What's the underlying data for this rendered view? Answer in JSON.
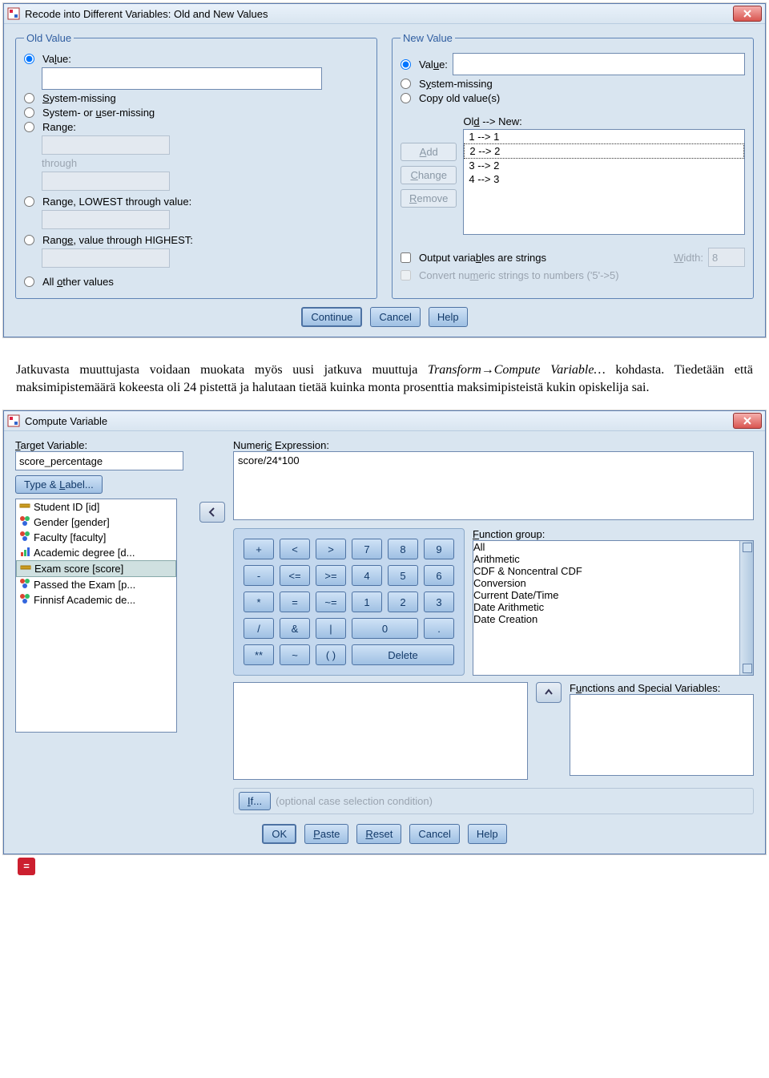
{
  "dialog1": {
    "title": "Recode into Different Variables: Old and New Values",
    "old": {
      "legend": "Old Value",
      "value_label": "Value:",
      "system_missing": "System-missing",
      "system_or_user": "System- or user-missing",
      "range_label": "Range:",
      "through": "through",
      "range_lowest": "Range, LOWEST through value:",
      "range_highest": "Range, value through HIGHEST:",
      "all_other": "All other values"
    },
    "new": {
      "legend": "New Value",
      "value_label": "Value:",
      "system_missing": "System-missing",
      "copy_old": "Copy old value(s)",
      "oldnew_label": "Old --> New:",
      "rules": [
        "1 --> 1",
        "2 --> 2",
        "3 --> 2",
        "4 --> 3"
      ],
      "add": "Add",
      "change": "Change",
      "remove": "Remove",
      "output_strings": "Output variables are strings",
      "width_label": "Width:",
      "width_value": "8",
      "convert": "Convert numeric strings to numbers ('5'->5)"
    },
    "buttons": {
      "continue": "Continue",
      "cancel": "Cancel",
      "help": "Help"
    }
  },
  "prose": {
    "p1a": "Jatkuvasta muuttujasta voidaan muokata myös uusi jatkuva muuttuja ",
    "p1b": "Transform→Compute Variable…",
    "p1c": " kohdasta. Tiedetään että maksimipistemäärä kokeesta oli 24 pistettä ja halutaan tietää kuinka monta prosenttia maksimipisteistä kukin opiskelija sai."
  },
  "dialog2": {
    "title": "Compute Variable",
    "target_label": "Target Variable:",
    "target_value": "score_percentage",
    "equals": "=",
    "type_label": "Type & Label...",
    "numexpr_label": "Numeric Expression:",
    "numexpr_value": "score/24*100",
    "vars": [
      {
        "label": "Student ID [id]",
        "icon": "ruler"
      },
      {
        "label": "Gender [gender]",
        "icon": "nom"
      },
      {
        "label": "Faculty [faculty]",
        "icon": "nom"
      },
      {
        "label": "Academic degree [d...",
        "icon": "ord"
      },
      {
        "label": "Exam score [score]",
        "icon": "ruler",
        "sel": true
      },
      {
        "label": "Passed the Exam [p...",
        "icon": "nom"
      },
      {
        "label": "Finnisf Academic de...",
        "icon": "nom"
      }
    ],
    "keypad": [
      [
        "+",
        "<",
        ">",
        "7",
        "8",
        "9"
      ],
      [
        "-",
        "<=",
        ">=",
        "4",
        "5",
        "6"
      ],
      [
        "*",
        "=",
        "~=",
        "1",
        "2",
        "3"
      ],
      [
        "/",
        "&",
        "|",
        "0",
        "",
        "."
      ],
      [
        "**",
        "~",
        "( )",
        "",
        "Delete",
        ""
      ]
    ],
    "fg_label": "Function group:",
    "fg": [
      "All",
      "Arithmetic",
      "CDF & Noncentral CDF",
      "Conversion",
      "Current Date/Time",
      "Date Arithmetic",
      "Date Creation"
    ],
    "fsv_label": "Functions and Special Variables:",
    "if_label": "If...",
    "if_hint": "(optional case selection condition)",
    "buttons": {
      "ok": "OK",
      "paste": "Paste",
      "reset": "Reset",
      "cancel": "Cancel",
      "help": "Help"
    }
  }
}
